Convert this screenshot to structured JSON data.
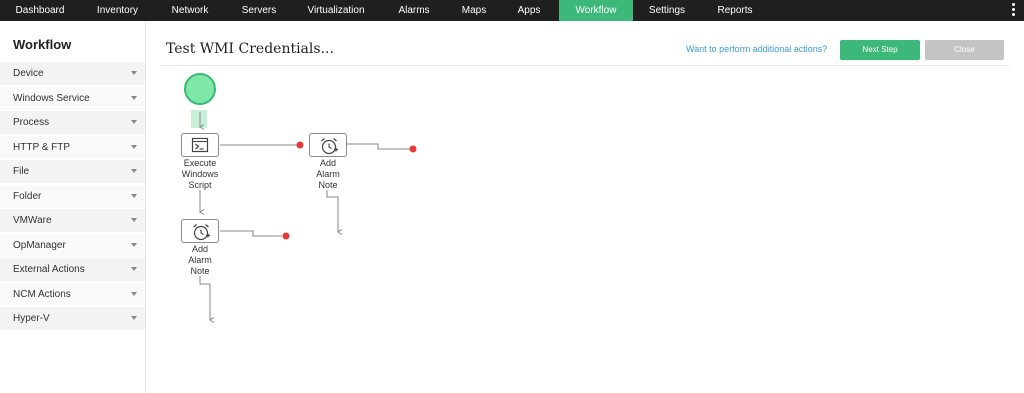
{
  "nav": {
    "items": [
      "Dashboard",
      "Inventory",
      "Network",
      "Servers",
      "Virtualization",
      "Alarms",
      "Maps",
      "Apps",
      "Workflow",
      "Settings",
      "Reports"
    ],
    "active": "Workflow"
  },
  "sidebar": {
    "title": "Workflow",
    "items": [
      "Device",
      "Windows Service",
      "Process",
      "HTTP & FTP",
      "File",
      "Folder",
      "VMWare",
      "OpManager",
      "External Actions",
      "NCM Actions",
      "Hyper-V"
    ]
  },
  "page": {
    "title": "Test WMI Credentials...",
    "link": "Want to perform additional actions?",
    "next_label": "Next Step",
    "close_label": "Close"
  },
  "workflow": {
    "nodes": [
      {
        "id": "execute-windows-script",
        "label": "Execute\nWindows\nScript",
        "icon": "terminal-icon"
      },
      {
        "id": "add-alarm-note-1",
        "label": "Add\nAlarm\nNote",
        "icon": "alarm-clock-icon"
      },
      {
        "id": "add-alarm-note-2",
        "label": "Add\nAlarm\nNote",
        "icon": "alarm-clock-icon"
      }
    ]
  },
  "colors": {
    "nav_bg": "#1f1f1f",
    "accent": "#3cb878",
    "start_node": "#7ee8a8",
    "end_point": "#e53935",
    "link": "#3a9ad9"
  }
}
